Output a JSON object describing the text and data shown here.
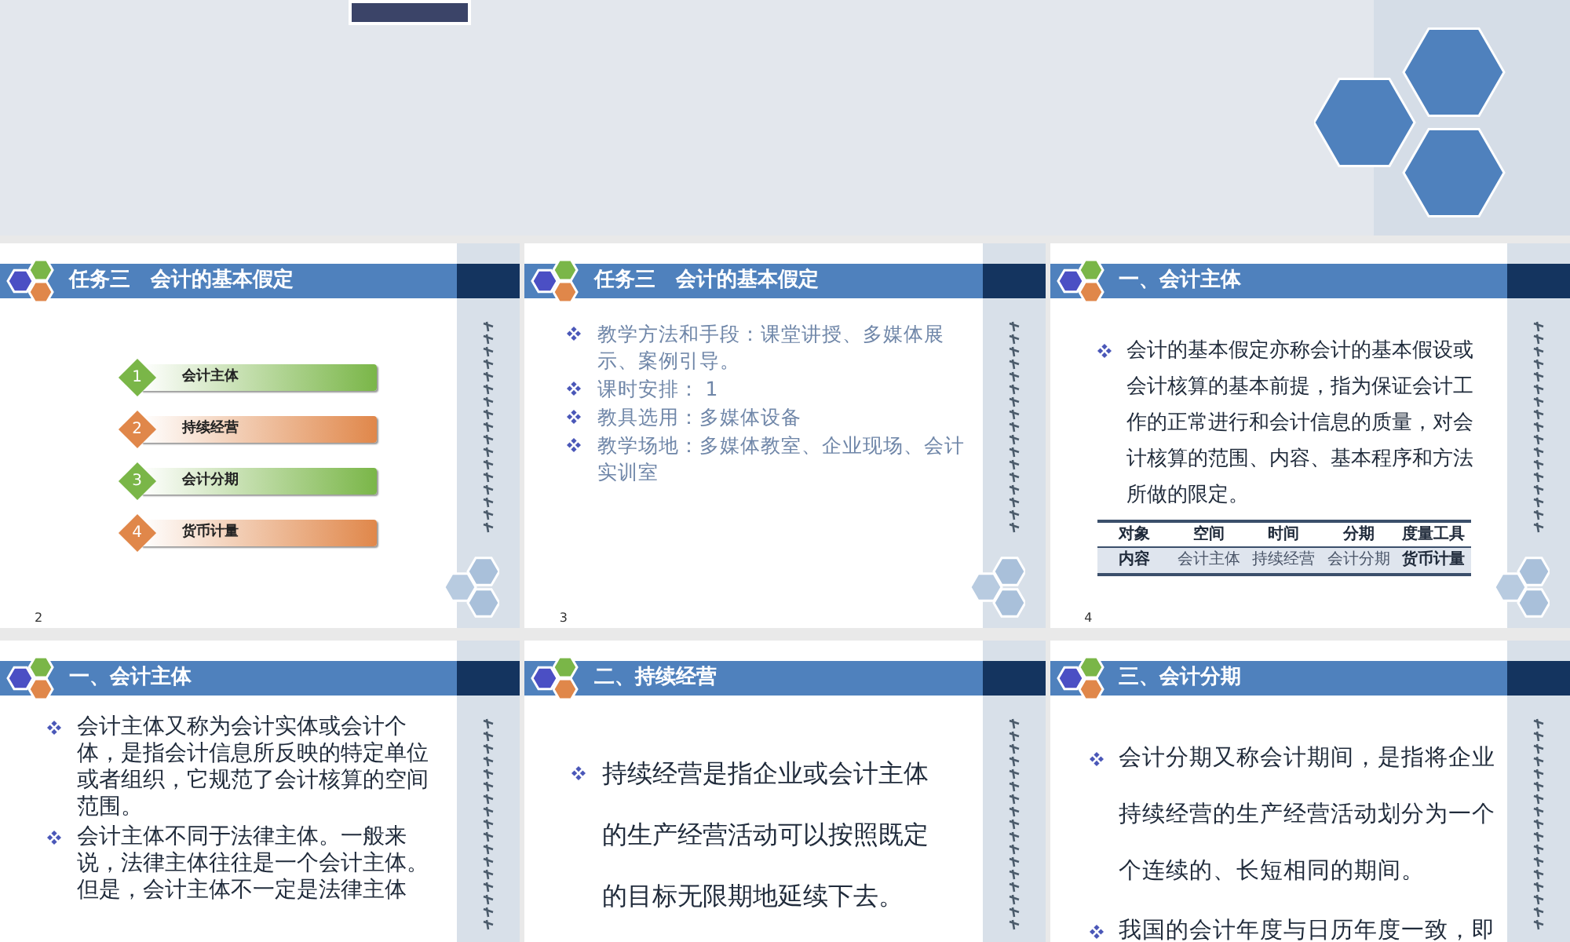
{
  "slides": [
    {
      "kind": "agenda",
      "title": "任务三　会计的基本假定",
      "number": "2",
      "items": [
        {
          "number": "1",
          "label": "会计主体",
          "color": "#7ab648"
        },
        {
          "number": "2",
          "label": "持续经营",
          "color": "#e0874a"
        },
        {
          "number": "3",
          "label": "会计分期",
          "color": "#7ab648"
        },
        {
          "number": "4",
          "label": "货币计量",
          "color": "#e0874a"
        }
      ]
    },
    {
      "kind": "plan",
      "title": "任务三　会计的基本假定",
      "number": "3",
      "bullets": [
        "教学方法和手段：课堂讲授、多媒体展示、案例引导。",
        "课时安排： 1",
        "教具选用：多媒体设备",
        "教学场地：多媒体教室、企业现场、会计实训室"
      ]
    },
    {
      "kind": "definition",
      "title": "一、会计主体",
      "number": "4",
      "bullets": [
        "会计的基本假定亦称会计的基本假设或会计核算的基本前提，指为保证会计工作的正常进行和会计信息的质量，对会计核算的范围、内容、基本程序和方法所做的限定。"
      ],
      "table": {
        "columns": [
          "对象",
          "空间",
          "时间",
          "分期",
          "度量工具"
        ],
        "rows": [
          [
            "内容",
            "会计主体",
            "持续经营",
            "会计分期",
            "货币计量"
          ]
        ]
      }
    },
    {
      "kind": "list",
      "title": "一、会计主体",
      "bullets": [
        "会计主体又称为会计实体或会计个体，是指会计信息所反映的特定单位或者组织，它规范了会计核算的空间范围。",
        "会计主体不同于法律主体。一般来说，法律主体往往是一个会计主体。但是，会计主体不一定是法律主体"
      ]
    },
    {
      "kind": "statement",
      "title": "二、持续经营",
      "bullets": [
        "持续经营是指企业或会计主体的生产经营活动可以按照既定的目标无限期地延续下去。"
      ]
    },
    {
      "kind": "spaced",
      "title": "三、会计分期",
      "bullets": [
        "会计分期又称会计期间，是指将企业持续经营的生产经营活动划分为一个个连续的、长短相同的期间。",
        "我国的会计年度与日历年度一致，即"
      ]
    }
  ]
}
